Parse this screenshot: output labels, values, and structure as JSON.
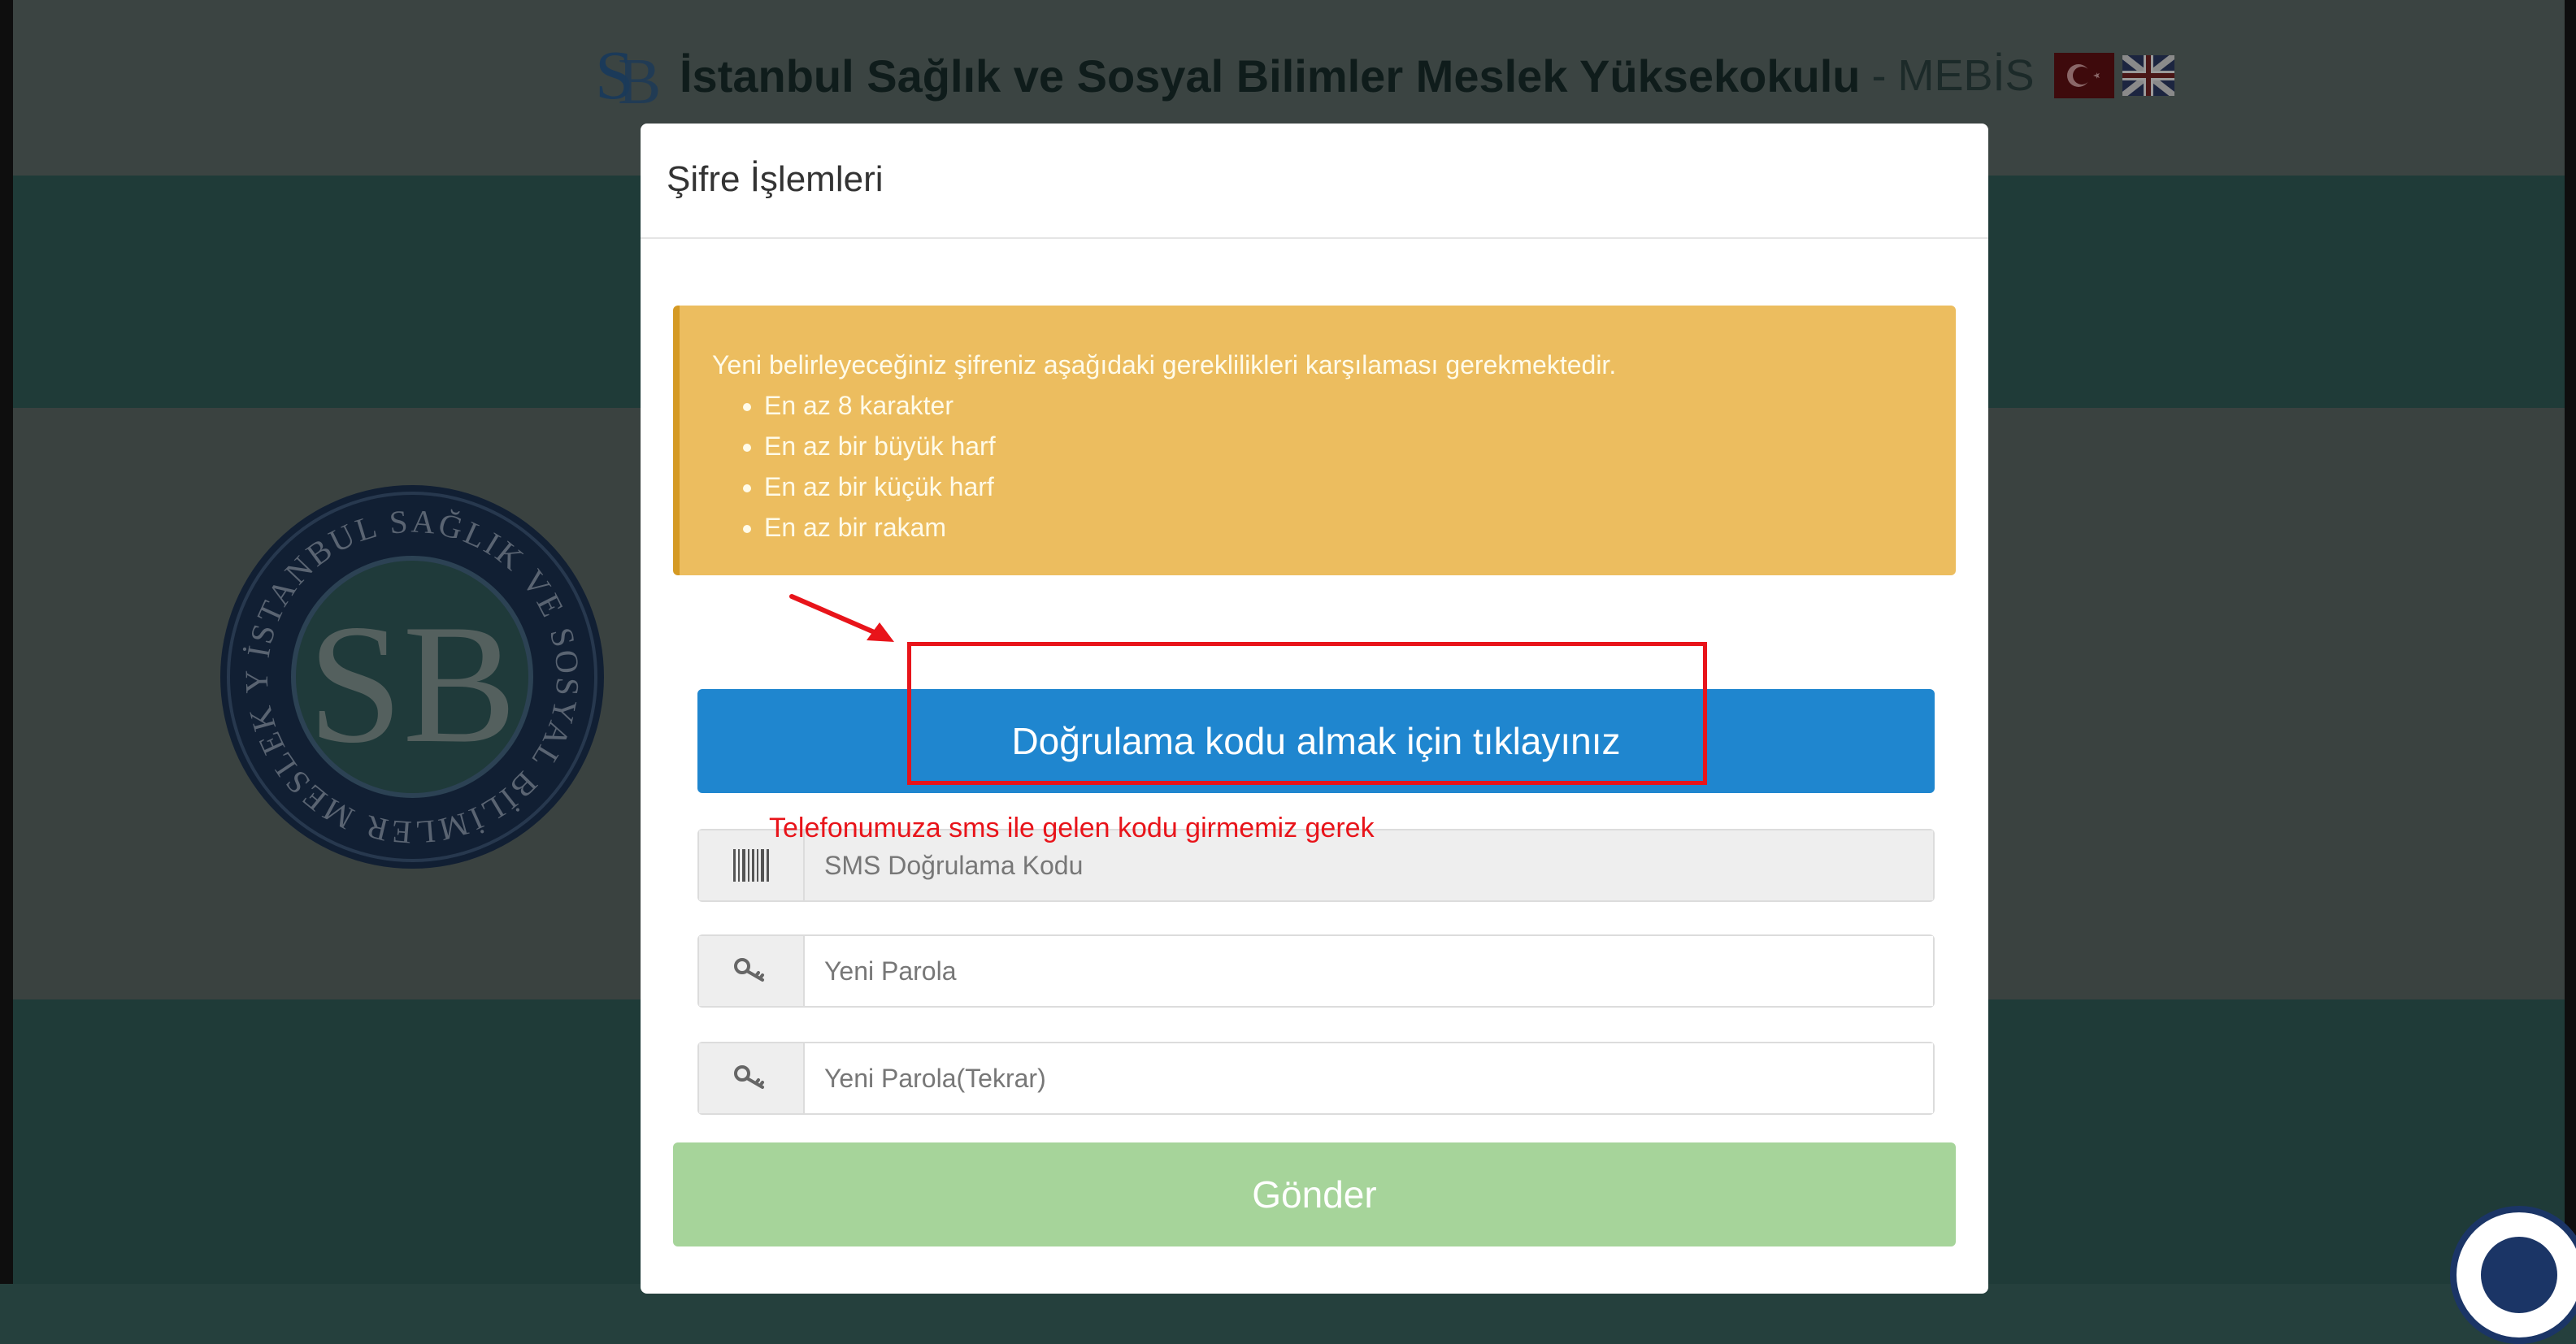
{
  "header": {
    "brand_name": "İstanbul Sağlık ve Sosyal Bilimler Meslek Yüksekokulu",
    "separator": "-",
    "brand_sub": "MEBİS",
    "languages": [
      "tr",
      "en"
    ]
  },
  "seal": {
    "ring_text": "İSTANBUL SAĞLIK VE SOSYAL BİLİMLER MESLEK YÜKSEKOKULU",
    "monogram": "SB"
  },
  "modal": {
    "title": "Şifre İşlemleri",
    "alert": {
      "intro": "Yeni belirleyeceğiniz şifreniz aşağıdaki gereklilikleri karşılaması gerekmektedir.",
      "requirements": [
        "En az 8 karakter",
        "En az bir büyük harf",
        "En az bir küçük harf",
        "En az bir rakam"
      ]
    },
    "verify_button": "Doğrulama kodu almak için tıklayınız",
    "sms_code": {
      "placeholder": "SMS Doğrulama Kodu",
      "icon": "barcode-icon"
    },
    "new_password": {
      "placeholder": "Yeni Parola",
      "icon": "key-icon"
    },
    "new_password_repeat": {
      "placeholder": "Yeni Parola(Tekrar)",
      "icon": "key-icon"
    },
    "submit_button": "Gönder"
  },
  "annotation": {
    "note": "Telefonumuza sms ile gelen kodu girmemiz gerek",
    "color": "#e8141a"
  },
  "colors": {
    "primary": "#1f86cf",
    "warning": "#ecbd5f",
    "success_disabled": "#a6d49a",
    "overlay": "#25403d"
  }
}
